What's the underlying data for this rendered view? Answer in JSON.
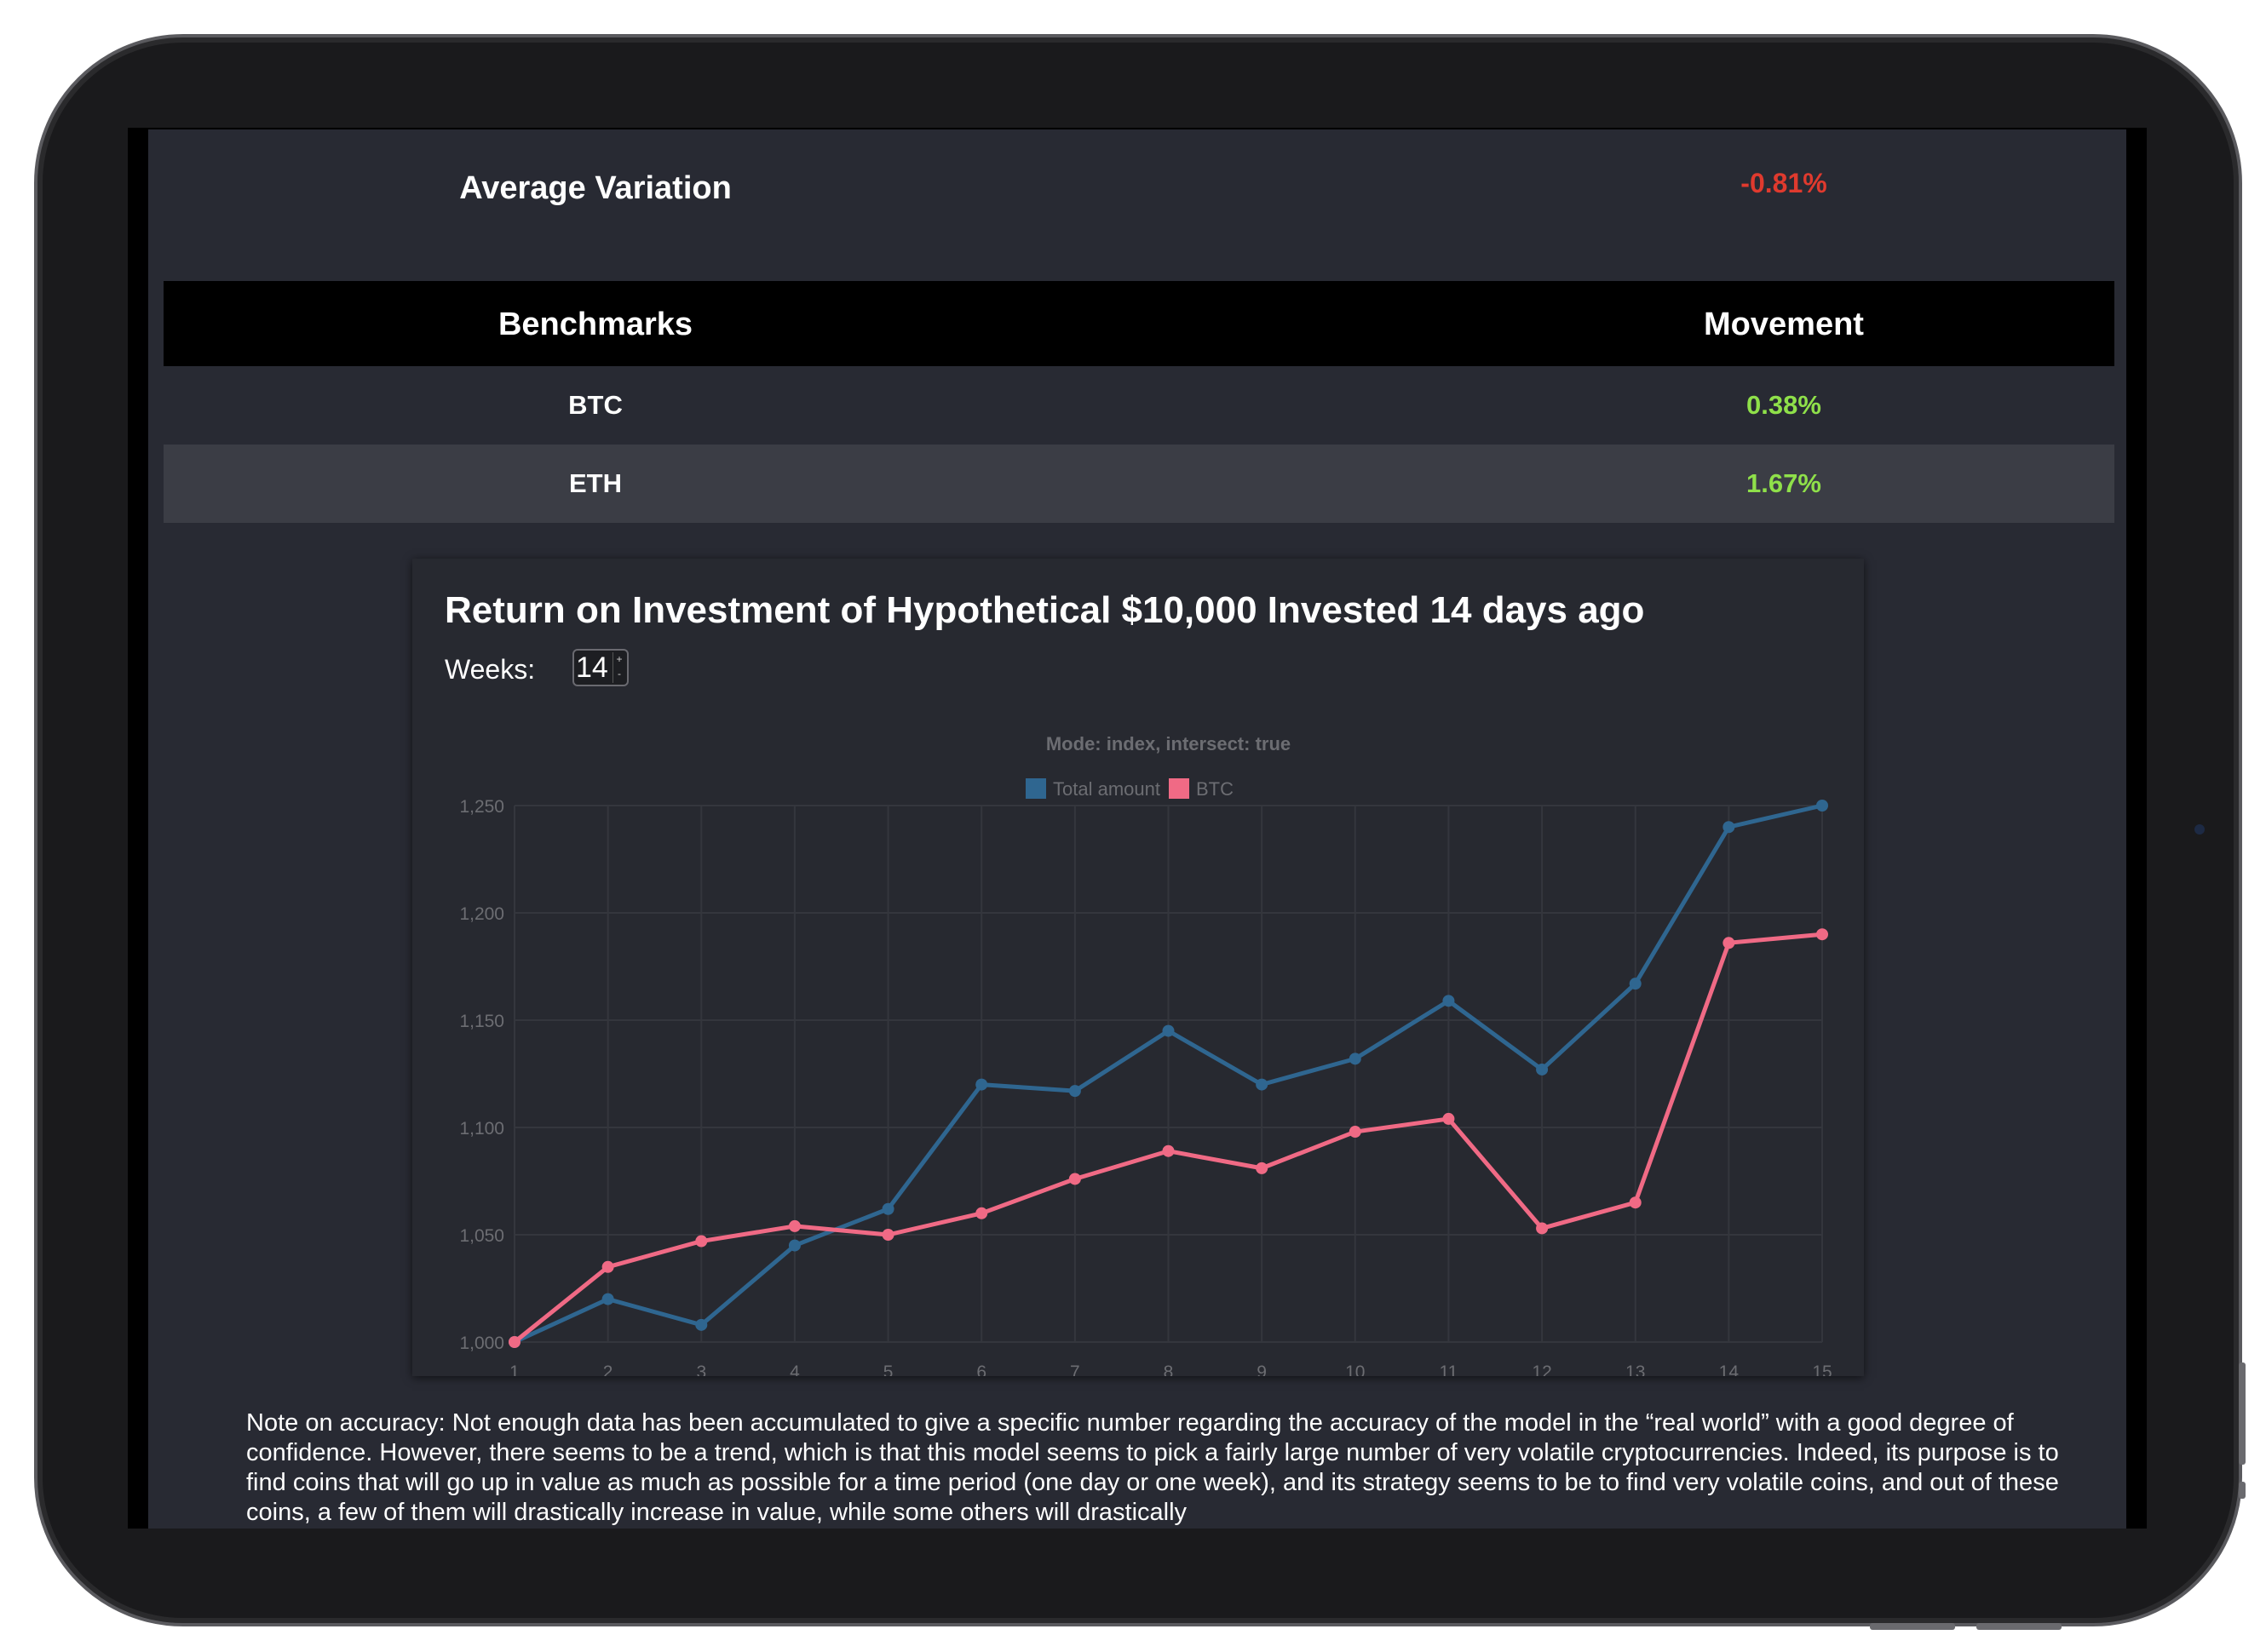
{
  "summary": {
    "avg_label": "Average Variation",
    "avg_value": "-0.81%"
  },
  "benchmarks": {
    "headers": [
      "Benchmarks",
      "Movement"
    ],
    "rows": [
      {
        "name": "BTC",
        "movement": "0.38%"
      },
      {
        "name": "ETH",
        "movement": "1.67%"
      }
    ]
  },
  "chart_panel": {
    "title": "Return on Investment of Hypothetical $10,000 Invested 14 days ago",
    "weeks_label": "Weeks:",
    "weeks_value": "14"
  },
  "chart_data": {
    "type": "line",
    "title": "Mode: index, intersect: true",
    "legend_position": "top",
    "grid": true,
    "x": [
      1,
      2,
      3,
      4,
      5,
      6,
      7,
      8,
      9,
      10,
      11,
      12,
      13,
      14,
      15
    ],
    "ylim": [
      1000,
      1250
    ],
    "yticks": [
      "1,000",
      "1,050",
      "1,100",
      "1,150",
      "1,200",
      "1,250"
    ],
    "ytick_values": [
      1000,
      1050,
      1100,
      1150,
      1200,
      1250
    ],
    "series": [
      {
        "name": "Total amount",
        "color": "#2f6690",
        "values": [
          1000,
          1020,
          1008,
          1045,
          1062,
          1120,
          1117,
          1145,
          1120,
          1132,
          1159,
          1127,
          1167,
          1240,
          1250
        ]
      },
      {
        "name": "BTC",
        "color": "#f06a85",
        "values": [
          1000,
          1035,
          1047,
          1054,
          1050,
          1060,
          1076,
          1089,
          1081,
          1098,
          1104,
          1053,
          1065,
          1186,
          1190
        ]
      }
    ]
  },
  "note": "Note on accuracy: Not enough data has been accumulated to give a specific number regarding the accuracy of the model in the “real world” with a good degree of confidence. However, there seems to be a trend, which is that this model seems to pick a fairly large number of very volatile cryptocurrencies. Indeed, its purpose is to find coins that will go up in value as much as possible for a time period (one day or one week), and its strategy seems to be to find very volatile coins, and out of these coins, a few of them will drastically increase in value, while some others will drastically"
}
